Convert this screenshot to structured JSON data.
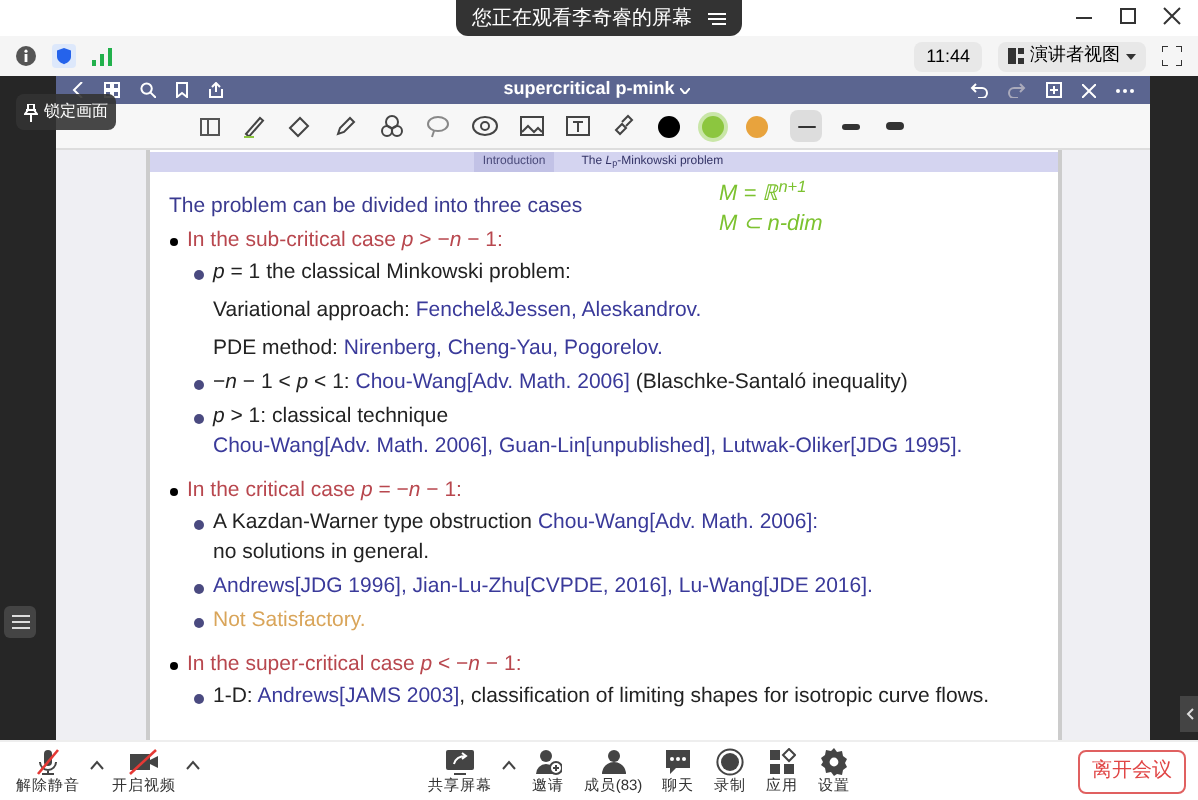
{
  "banner": {
    "text": "您正在观看李奇睿的屏幕"
  },
  "status": {
    "time": "11:44",
    "view_button": "演讲者视图"
  },
  "tooltip": {
    "text": "锁定画面"
  },
  "app": {
    "title": "supercritical p-mink"
  },
  "pen_colors": [
    {
      "color": "#000000",
      "selected": false
    },
    {
      "color": "#8cc63f",
      "selected": true
    },
    {
      "color": "#e8a33d",
      "selected": false
    }
  ],
  "strokes": [
    {
      "selected": true
    },
    {
      "selected": false
    },
    {
      "selected": false
    }
  ],
  "slide": {
    "tabs": [
      {
        "label": "Introduction",
        "selected": false
      },
      {
        "label": "The *L*$_{p}$-Minkowski problem",
        "selected": true
      }
    ],
    "intro": "The problem can be divided into three cases",
    "annotations": [
      "M = ℝ$^{n+1}$",
      "M ⊂ n-dim"
    ],
    "sections": [
      {
        "heading": "In the sub-critical case *p* > −*n* − 1:",
        "items": [
          {
            "kind": "bullet",
            "lines": [
              [
                {
                  "kind": "text",
                  "text": "*p* = 1 the classical Minkowski problem:"
                }
              ]
            ]
          },
          {
            "kind": "paragraph",
            "lines": [
              [
                {
                  "kind": "text",
                  "text": "Variational approach: "
                },
                {
                  "kind": "link",
                  "text": "Fenchel&Jessen, Aleskandrov."
                }
              ]
            ]
          },
          {
            "kind": "paragraph",
            "lines": [
              [
                {
                  "kind": "text",
                  "text": "PDE method: "
                },
                {
                  "kind": "link",
                  "text": "Nirenberg, Cheng-Yau, Pogorelov."
                }
              ]
            ]
          },
          {
            "kind": "bullet",
            "lines": [
              [
                {
                  "kind": "text",
                  "text": "−*n* − 1 < *p* < 1: "
                },
                {
                  "kind": "link",
                  "text": "Chou-Wang[Adv. Math. 2006]"
                },
                {
                  "kind": "text",
                  "text": " (Blaschke-Santaló inequality)"
                }
              ]
            ]
          },
          {
            "kind": "bullet",
            "lines": [
              [
                {
                  "kind": "text",
                  "text": "*p* > 1: classical technique"
                }
              ],
              [
                {
                  "kind": "link",
                  "text": "Chou-Wang[Adv. Math. 2006], Guan-Lin[unpublished], Lutwak-Oliker[JDG 1995]."
                }
              ]
            ]
          }
        ]
      },
      {
        "heading": "In the critical case *p* = −*n* − 1:",
        "items": [
          {
            "kind": "bullet",
            "lines": [
              [
                {
                  "kind": "text",
                  "text": "A Kazdan-Warner type obstruction "
                },
                {
                  "kind": "link",
                  "text": "Chou-Wang[Adv. Math. 2006]:"
                }
              ],
              [
                {
                  "kind": "text",
                  "text": "no solutions in general."
                }
              ]
            ]
          },
          {
            "kind": "bullet",
            "lines": [
              [
                {
                  "kind": "link",
                  "text": "Andrews[JDG 1996], Jian-Lu-Zhu[CVPDE, 2016], Lu-Wang[JDE 2016]."
                }
              ]
            ]
          },
          {
            "kind": "bullet",
            "lines": [
              [
                {
                  "kind": "note",
                  "text": "Not Satisfactory."
                }
              ]
            ]
          }
        ]
      },
      {
        "heading": "In the super-critical case *p* < −*n* − 1:",
        "items": [
          {
            "kind": "bullet",
            "lines": [
              [
                {
                  "kind": "text",
                  "text": "1-D: "
                },
                {
                  "kind": "link",
                  "text": "Andrews[JAMS 2003]"
                },
                {
                  "kind": "text",
                  "text": ", classification of limiting shapes for isotropic curve flows."
                }
              ]
            ]
          }
        ]
      }
    ]
  },
  "toolbar": [
    {
      "label": "解除静音",
      "kind": "mic",
      "caret": true
    },
    {
      "label": "开启视频",
      "kind": "video",
      "caret": true
    },
    {
      "label": "共享屏幕",
      "kind": "share",
      "caret": true
    },
    {
      "label": "邀请",
      "kind": "invite",
      "caret": false
    },
    {
      "label": "成员(83)",
      "kind": "members",
      "caret": false
    },
    {
      "label": "聊天",
      "kind": "chat",
      "caret": false
    },
    {
      "label": "录制",
      "kind": "record",
      "caret": false
    },
    {
      "label": "应用",
      "kind": "apps",
      "caret": false
    },
    {
      "label": "设置",
      "kind": "settings",
      "caret": false
    }
  ],
  "leave_button": "离开会议"
}
